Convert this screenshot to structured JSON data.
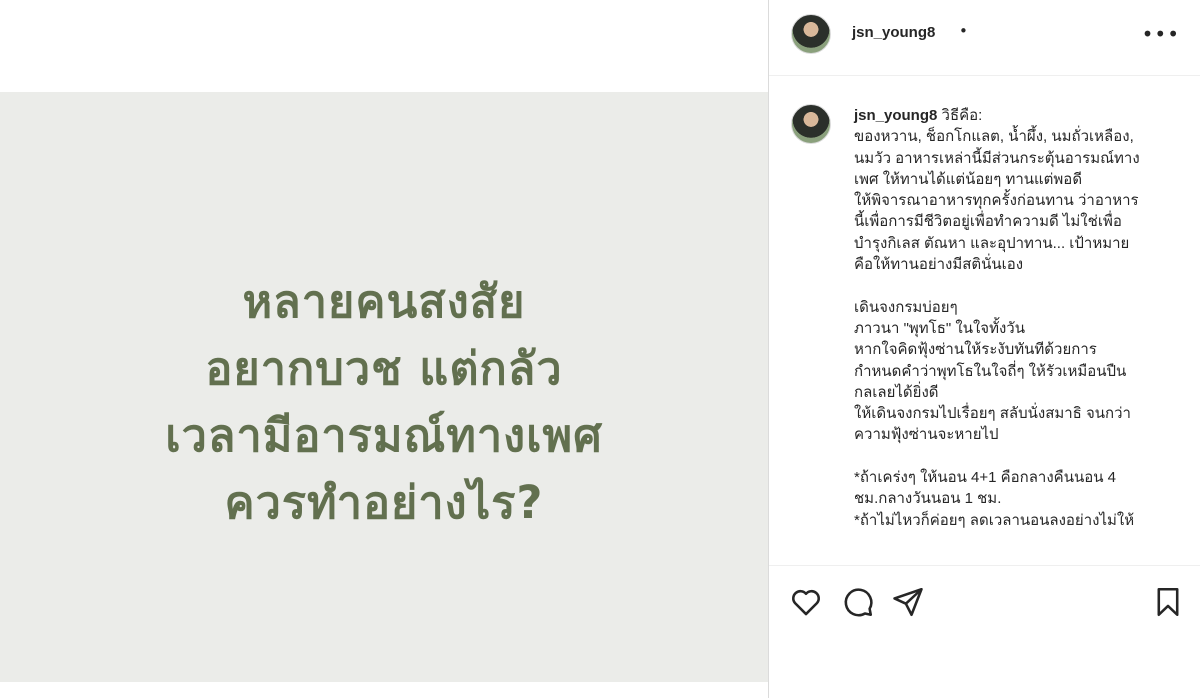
{
  "post": {
    "image_text": [
      "หลายคนสงสัย",
      "อยากบวช แต่กลัว",
      "เวลามีอารมณ์ทางเพศ",
      "ควรทำอย่างไร?"
    ],
    "colors": {
      "image_bg": "#ebece9",
      "image_text": "#62704f"
    }
  },
  "header": {
    "username": "jsn_young8",
    "separator": "•",
    "more_icon": "more-options-icon"
  },
  "caption": {
    "username": "jsn_young8",
    "first_line": " วิธีคือ:",
    "lines": [
      "ของหวาน, ช็อกโกแลต, น้ำผึ้ง, นมถั่วเหลือง,",
      "นมวัว อาหารเหล่านี้มีส่วนกระตุ้นอารมณ์ทาง",
      "เพศ ให้ทานได้แต่น้อยๆ ทานแต่พอดี",
      "ให้พิจารณาอาหารทุกครั้งก่อนทาน ว่าอาหาร",
      "นี้เพื่อการมีชีวิตอยู่เพื่อทำความดี ไม่ใช่เพื่อ",
      "บำรุงกิเลส ตัณหา และอุปาทาน... เป้าหมาย",
      "คือให้ทานอย่างมีสตินั่นเอง",
      "",
      "เดินจงกรมบ่อยๆ",
      "ภาวนา \"พุทโธ\" ในใจทั้งวัน",
      "หากใจคิดฟุ้งซ่านให้ระงับทันทีด้วยการ",
      "กำหนดคำว่าพุทโธในใจถี่ๆ ให้รัวเหมือนปืน",
      "กลเลยได้ยิ่งดี",
      "ให้เดินจงกรมไปเรื่อยๆ สลับนั่งสมาธิ จนกว่า",
      "ความฟุ้งซ่านจะหายไป",
      "",
      "*ถ้าเคร่งๆ ให้นอน 4+1 คือกลางคืนนอน 4",
      "ชม.กลางวันนอน 1 ชม.",
      "*ถ้าไม่ไหวก็ค่อยๆ ลดเวลานอนลงอย่างไม่ให้"
    ]
  },
  "actions": {
    "like": "heart-icon",
    "comment": "comment-icon",
    "share": "paper-plane-icon",
    "save": "bookmark-icon"
  }
}
